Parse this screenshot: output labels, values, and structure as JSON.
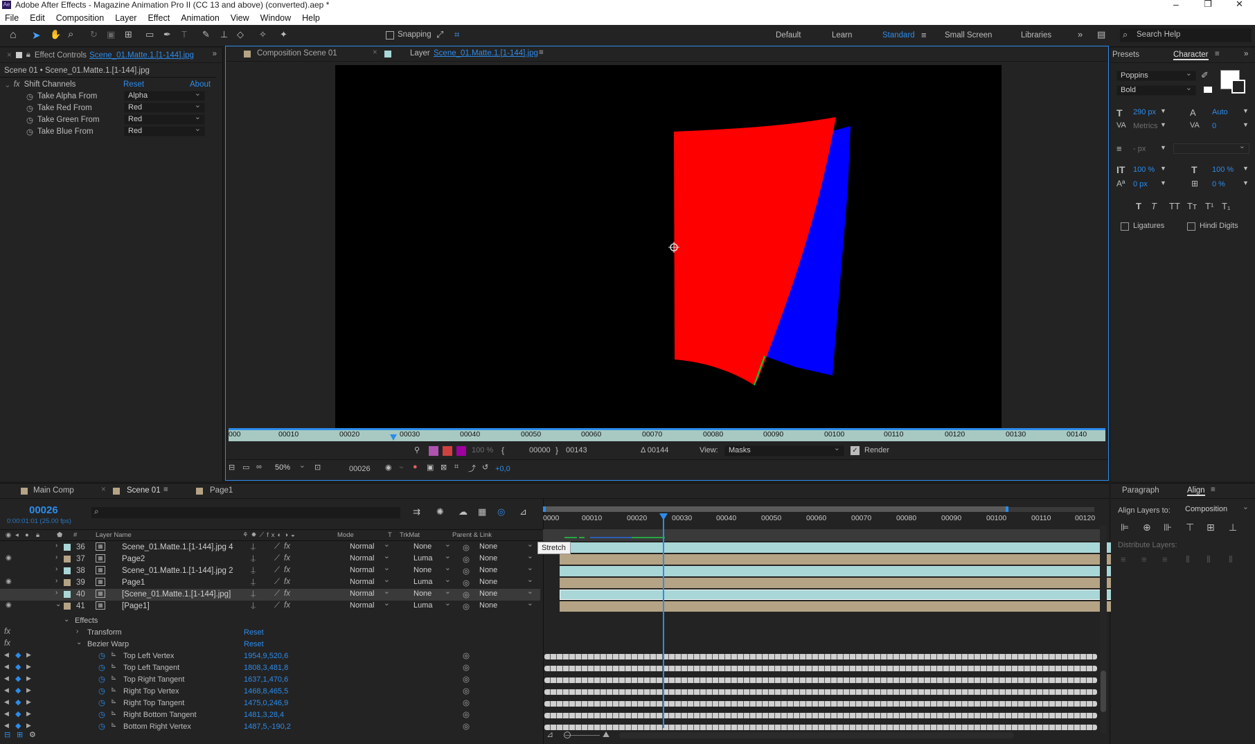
{
  "app": {
    "title": "Adobe After Effects - Magazine Animation Pro II (CC 13 and above) (converted).aep *",
    "logo": "Ae"
  },
  "menu": [
    "File",
    "Edit",
    "Composition",
    "Layer",
    "Effect",
    "Animation",
    "View",
    "Window",
    "Help"
  ],
  "window_buttons": [
    "–",
    "❐",
    "✕"
  ],
  "toolbar": {
    "snapping": "Snapping",
    "workspaces": [
      "Default",
      "Learn",
      "Standard",
      "Small Screen",
      "Libraries"
    ],
    "active_workspace": "Standard",
    "search": "Search Help"
  },
  "effect_controls": {
    "tab_prefix": "Effect Controls",
    "tab_layer": "Scene_01.Matte.1.[1-144].jpg",
    "subtitle": "Scene 01 • Scene_01.Matte.1.[1-144].jpg",
    "effect_name": "Shift Channels",
    "reset": "Reset",
    "about": "About",
    "props": [
      {
        "label": "Take Alpha From",
        "value": "Alpha"
      },
      {
        "label": "Take Red From",
        "value": "Red"
      },
      {
        "label": "Take Green From",
        "value": "Red"
      },
      {
        "label": "Take Blue From",
        "value": "Red"
      }
    ]
  },
  "viewer": {
    "tab_comp": "Composition Scene 01",
    "tab_layer_prefix": "Layer",
    "tab_layer": "Scene_01.Matte.1.[1-144].jpg",
    "ruler": [
      "000",
      "00010",
      "00020",
      "00030",
      "00040",
      "00050",
      "00060",
      "00070",
      "00080",
      "00090",
      "00100",
      "00110",
      "00120",
      "00130",
      "00140"
    ],
    "in": "00000",
    "out": "00143",
    "duration": "Δ 00144",
    "view_label": "View:",
    "view_value": "Masks",
    "render": "Render",
    "zoom": "50%",
    "frame": "00026",
    "opacity": "100 %",
    "exposure": "+0,0"
  },
  "right_panel": {
    "tab_presets": "Presets",
    "tab_character": "Character",
    "font": "Poppins",
    "style": "Bold",
    "size": "290 px",
    "leading": "Auto",
    "kerning": "Metrics",
    "tracking": "0",
    "stroke": "- px",
    "vscale": "100 %",
    "hscale": "100 %",
    "baseline": "0 px",
    "tsume": "0 %",
    "ligatures": "Ligatures",
    "hindi": "Hindi Digits",
    "typo": [
      "T",
      "T",
      "TT",
      "Tт",
      "T¹",
      "T₁"
    ],
    "tab_paragraph": "Paragraph",
    "tab_align": "Align",
    "align_to_label": "Align Layers to:",
    "align_to": "Composition",
    "distribute": "Distribute Layers:"
  },
  "timeline": {
    "tabs": [
      "Main Comp",
      "Scene 01",
      "Page1"
    ],
    "active_tab": "Scene 01",
    "timecode": "00026",
    "fps": "0:00:01:01 (25.00 fps)",
    "col_headers": {
      "layer_name": "Layer Name",
      "mode": "Mode",
      "t": "T",
      "trkmat": "TrkMat",
      "parent": "Parent & Link"
    },
    "ruler": [
      "0000",
      "00010",
      "00020",
      "00030",
      "00040",
      "00050",
      "00060",
      "00070",
      "00080",
      "00090",
      "00100",
      "00110",
      "00120"
    ],
    "tooltip": "Stretch",
    "layers": [
      {
        "num": "36",
        "name": "Scene_01.Matte.1.[1-144].jpg 4",
        "mode": "Normal",
        "trk": "None",
        "parent": "None",
        "color": "#a9d6d6",
        "eye": false
      },
      {
        "num": "37",
        "name": "Page2",
        "mode": "Normal",
        "trk": "Luma",
        "parent": "None",
        "color": "#b5a385",
        "eye": true
      },
      {
        "num": "38",
        "name": "Scene_01.Matte.1.[1-144].jpg 2",
        "mode": "Normal",
        "trk": "None",
        "parent": "None",
        "color": "#a9d6d6",
        "eye": false
      },
      {
        "num": "39",
        "name": "Page1",
        "mode": "Normal",
        "trk": "Luma",
        "parent": "None",
        "color": "#b5a385",
        "eye": true
      },
      {
        "num": "40",
        "name": "[Scene_01.Matte.1.[1-144].jpg]",
        "mode": "Normal",
        "trk": "None",
        "parent": "None",
        "color": "#a9d6d6",
        "eye": false
      },
      {
        "num": "41",
        "name": "[Page1]",
        "mode": "Normal",
        "trk": "Luma",
        "parent": "None",
        "color": "#b5a385",
        "eye": true
      }
    ],
    "effects": {
      "label": "Effects",
      "transform": "Transform",
      "bezier": "Bezier Warp",
      "reset": "Reset"
    },
    "props": [
      {
        "name": "Top Left Vertex",
        "value": "1954,9,520,6"
      },
      {
        "name": "Top Left Tangent",
        "value": "1808,3,481,8"
      },
      {
        "name": "Top Right Tangent",
        "value": "1637,1,470,6"
      },
      {
        "name": "Right Top Vertex",
        "value": "1468,8,465,5"
      },
      {
        "name": "Right Top Tangent",
        "value": "1475,0,246,9"
      },
      {
        "name": "Right Bottom Tangent",
        "value": "1481,3,28,4"
      },
      {
        "name": "Bottom Right Vertex",
        "value": "1487,5,-190,2"
      }
    ]
  },
  "colors": {
    "accent": "#2d8ceb",
    "red_shape": "#ff0000",
    "blue_shape": "#0000ff"
  }
}
